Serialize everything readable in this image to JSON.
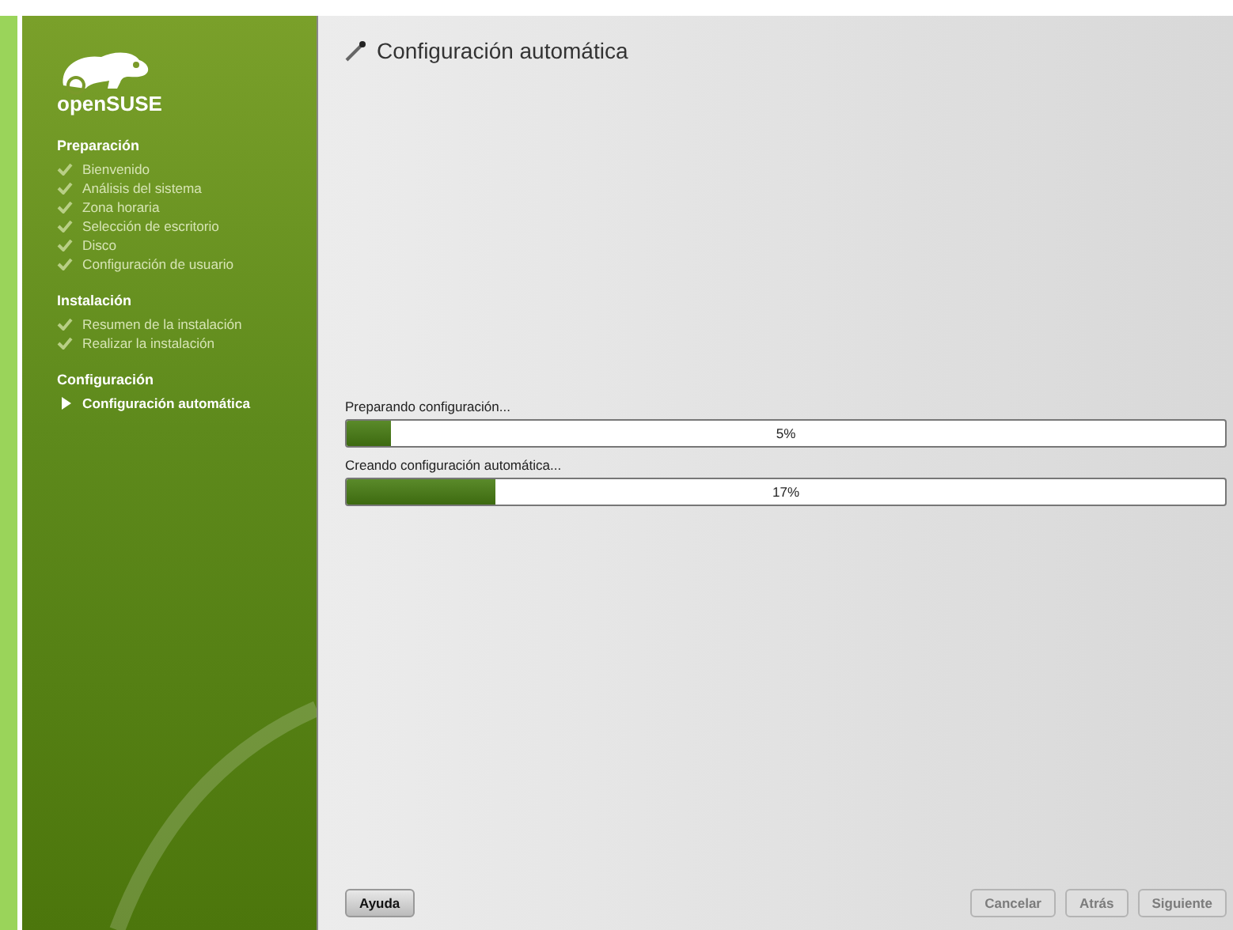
{
  "sidebar": {
    "logo_text": "openSUSE",
    "sections": [
      {
        "title": "Preparación",
        "steps": [
          {
            "label": "Bienvenido",
            "kind": "done"
          },
          {
            "label": "Análisis del sistema",
            "kind": "done"
          },
          {
            "label": "Zona horaria",
            "kind": "done"
          },
          {
            "label": "Selección de escritorio",
            "kind": "done"
          },
          {
            "label": "Disco",
            "kind": "done"
          },
          {
            "label": "Configuración de usuario",
            "kind": "done"
          }
        ]
      },
      {
        "title": "Instalación",
        "steps": [
          {
            "label": "Resumen de la instalación",
            "kind": "done"
          },
          {
            "label": "Realizar la instalación",
            "kind": "done"
          }
        ]
      },
      {
        "title": "Configuración",
        "steps": [
          {
            "label": "Configuración automática",
            "kind": "current"
          }
        ]
      }
    ]
  },
  "page_title": "Configuración automática",
  "progress": [
    {
      "label": "Preparando configuración...",
      "level": 0.05,
      "reading": "5%"
    },
    {
      "label": "Creando configuración automática...",
      "level": 0.17,
      "reading": "17%"
    }
  ],
  "buttons": {
    "help": {
      "label": "Ayuda",
      "disabled": false
    },
    "actions": [
      {
        "label": "Cancelar",
        "disabled": true
      },
      {
        "label": "Atrás",
        "disabled": true
      },
      {
        "label": "Siguiente",
        "disabled": true
      }
    ]
  }
}
